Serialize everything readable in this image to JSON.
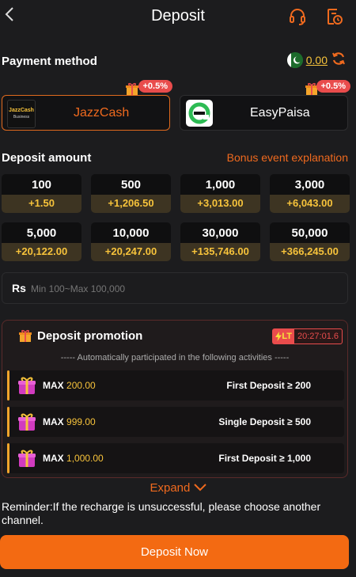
{
  "header": {
    "title": "Deposit",
    "back_icon": "chevron-left-icon",
    "support_icon": "headset-icon",
    "history_icon": "record-clock-icon"
  },
  "payment": {
    "title": "Payment method",
    "balance": "0.00",
    "methods": [
      {
        "name": "JazzCash",
        "badge": "+0.5%",
        "logo_text": "JazzCash",
        "logo_sub": "Business",
        "active": true
      },
      {
        "name": "EasyPaisa",
        "badge": "+0.5%",
        "active": false
      }
    ]
  },
  "deposit": {
    "title": "Deposit amount",
    "bonus_link": "Bonus event explanation",
    "amounts": [
      {
        "value": "100",
        "bonus": "+1.50"
      },
      {
        "value": "500",
        "bonus": "+1,206.50"
      },
      {
        "value": "1,000",
        "bonus": "+3,013.00"
      },
      {
        "value": "3,000",
        "bonus": "+6,043.00"
      },
      {
        "value": "5,000",
        "bonus": "+20,122.00"
      },
      {
        "value": "10,000",
        "bonus": "+20,247.00"
      },
      {
        "value": "30,000",
        "bonus": "+135,746.00"
      },
      {
        "value": "50,000",
        "bonus": "+366,245.00"
      }
    ],
    "currency": "Rs",
    "placeholder": "Min 100~Max 100,000"
  },
  "promotion": {
    "title": "Deposit promotion",
    "lt_label": "LT",
    "timer": "20:27:01.6",
    "subtitle": "----- Automatically participated in the following activities -----",
    "items": [
      {
        "max_label": "MAX",
        "max_value": "200.00",
        "condition": "First Deposit ≥ 200"
      },
      {
        "max_label": "MAX",
        "max_value": "999.00",
        "condition": "Single Deposit ≥ 500"
      },
      {
        "max_label": "MAX",
        "max_value": "1,000.00",
        "condition": "First Deposit ≥ 1,000"
      }
    ],
    "expand": "Expand"
  },
  "reminder": "Reminder:If the recharge is unsuccessful, please choose another channel.",
  "submit": "Deposit Now",
  "colors": {
    "accent": "#f36a12",
    "gold": "#f7c33b",
    "badge": "#e94c4c"
  }
}
